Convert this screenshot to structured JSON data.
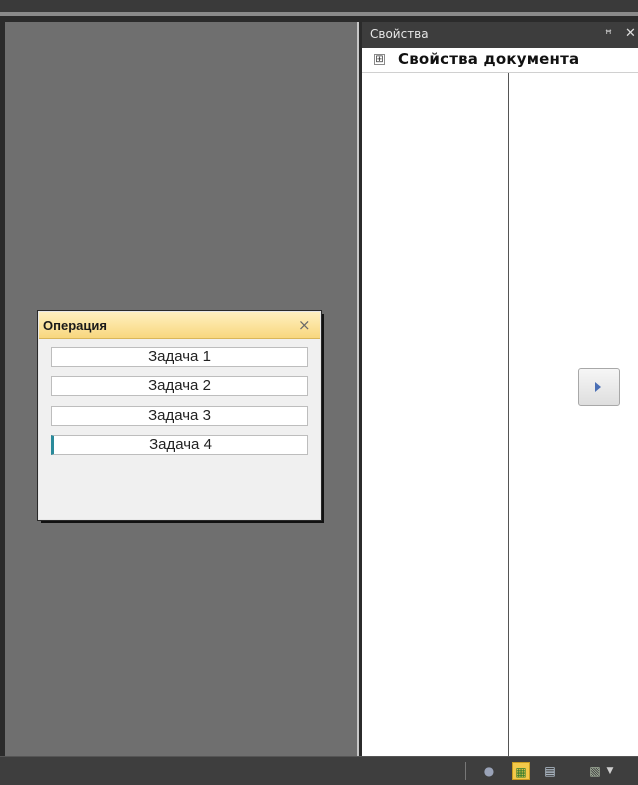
{
  "properties_panel": {
    "title": "Свойства",
    "pin_icon": "pin-icon",
    "close_icon": "close-icon",
    "section_label": "Свойства документа",
    "expand_symbol": "⊞"
  },
  "operation_window": {
    "title": "Операция",
    "close_symbol": "×",
    "tasks": [
      "Задача 1",
      "Задача 2",
      "Задача 3",
      "Задача 4"
    ]
  },
  "colors": {
    "canvas_bg": "#6f6f6f",
    "window_title_bg": "#f8d77e",
    "status_active": "#f3c94a"
  },
  "statusbar": {
    "icons": [
      "search-icon",
      "grid-icon",
      "document-icon",
      "page-icon",
      "chevron-down-icon"
    ]
  }
}
